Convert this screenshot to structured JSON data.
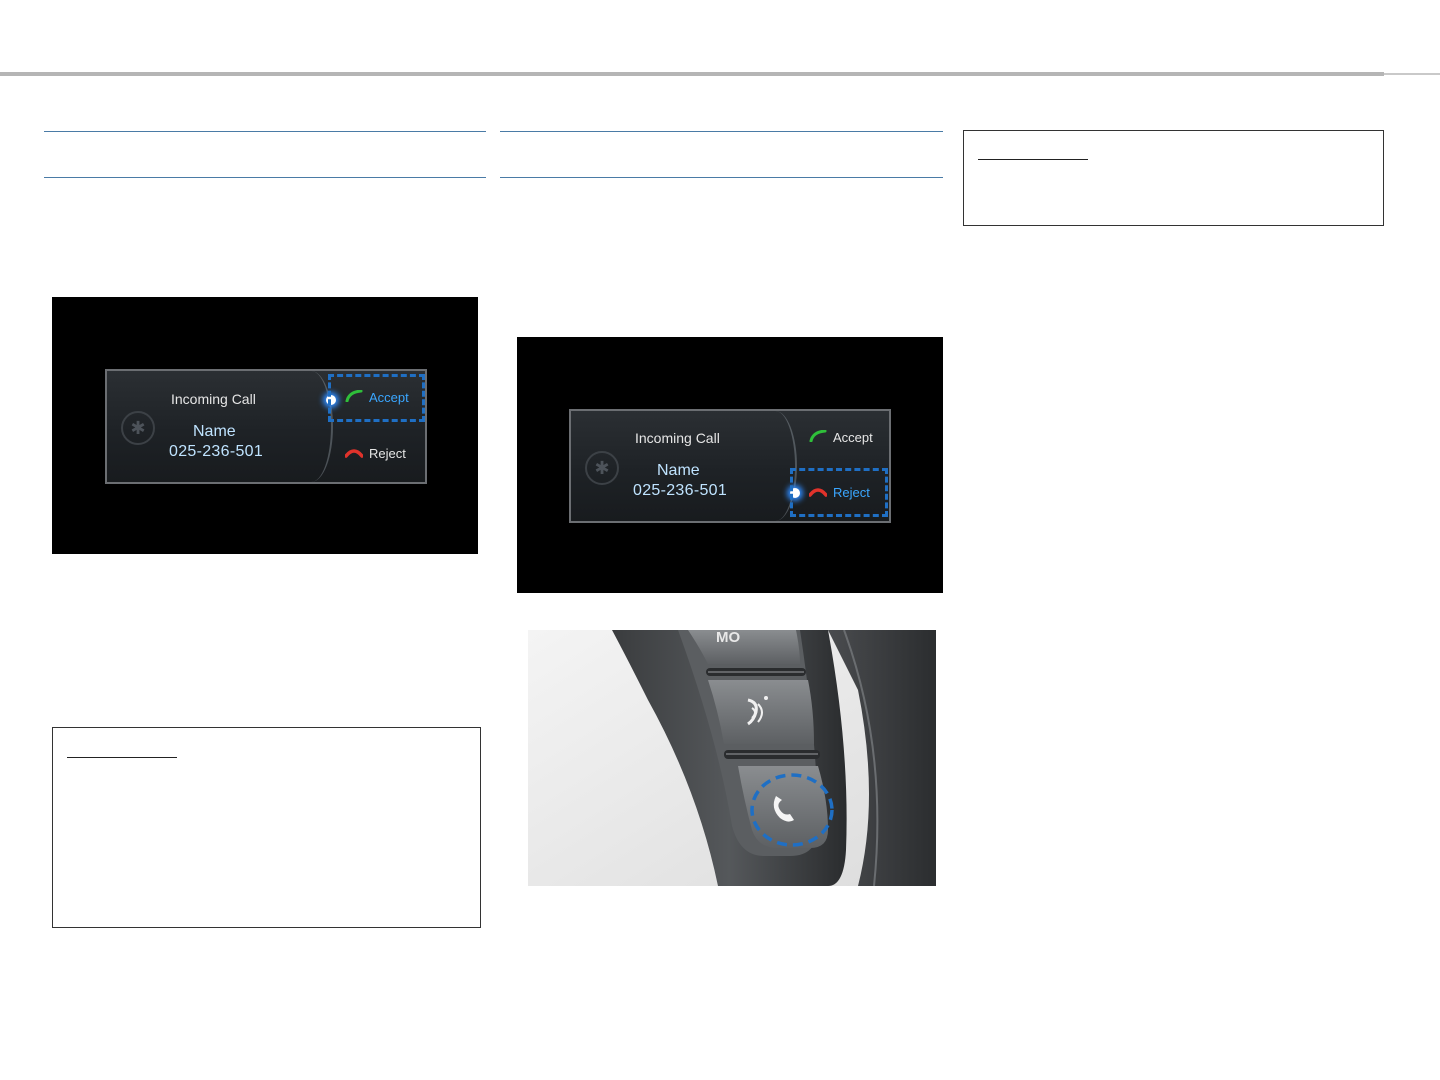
{
  "screens": [
    {
      "incoming_label": "Incoming Call",
      "caller_name": "Name",
      "caller_number": "025-236-501",
      "accept_label": "Accept",
      "reject_label": "Reject",
      "highlighted_option": "accept"
    },
    {
      "incoming_label": "Incoming Call",
      "caller_name": "Name",
      "caller_number": "025-236-501",
      "accept_label": "Accept",
      "reject_label": "Reject",
      "highlighted_option": "reject"
    }
  ],
  "wheel_photo": {
    "button_label_partial": "MO",
    "highlighted_button": "phone-button"
  },
  "colors": {
    "rule": "#b5b5b5",
    "section_line": "#4a7ba6",
    "highlight_dash": "#1f6fc4",
    "accept_green": "#2fbf3a",
    "reject_red": "#e0322b",
    "active_text": "#3aa6ff"
  }
}
